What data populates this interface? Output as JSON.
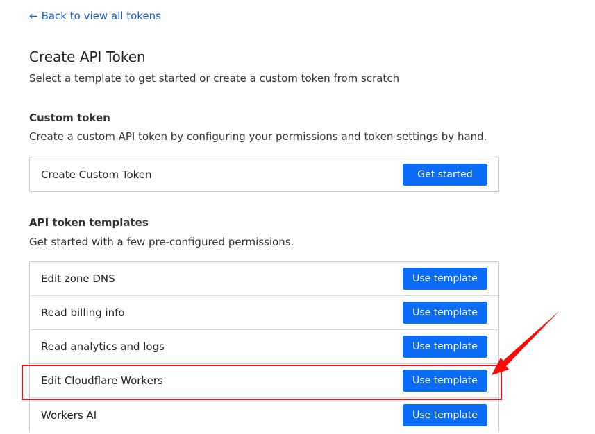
{
  "back_link": {
    "arrow": "←",
    "label": "Back to view all tokens"
  },
  "page": {
    "title": "Create API Token",
    "subtitle": "Select a template to get started or create a custom token from scratch"
  },
  "custom_token": {
    "heading": "Custom token",
    "description": "Create a custom API token by configuring your permissions and token settings by hand.",
    "row_label": "Create Custom Token",
    "button_label": "Get started"
  },
  "templates": {
    "heading": "API token templates",
    "description": "Get started with a few pre-configured permissions.",
    "items": [
      {
        "label": "Edit zone DNS",
        "button": "Use template"
      },
      {
        "label": "Read billing info",
        "button": "Use template"
      },
      {
        "label": "Read analytics and logs",
        "button": "Use template"
      },
      {
        "label": "Edit Cloudflare Workers",
        "button": "Use template"
      },
      {
        "label": "Workers AI",
        "button": "Use template"
      }
    ]
  },
  "annotation": {
    "highlight_color": "#e0161b",
    "highlighted_item": "Edit Cloudflare Workers"
  },
  "colors": {
    "primary_button": "#0b6cf7",
    "link": "#1d5cc7"
  }
}
